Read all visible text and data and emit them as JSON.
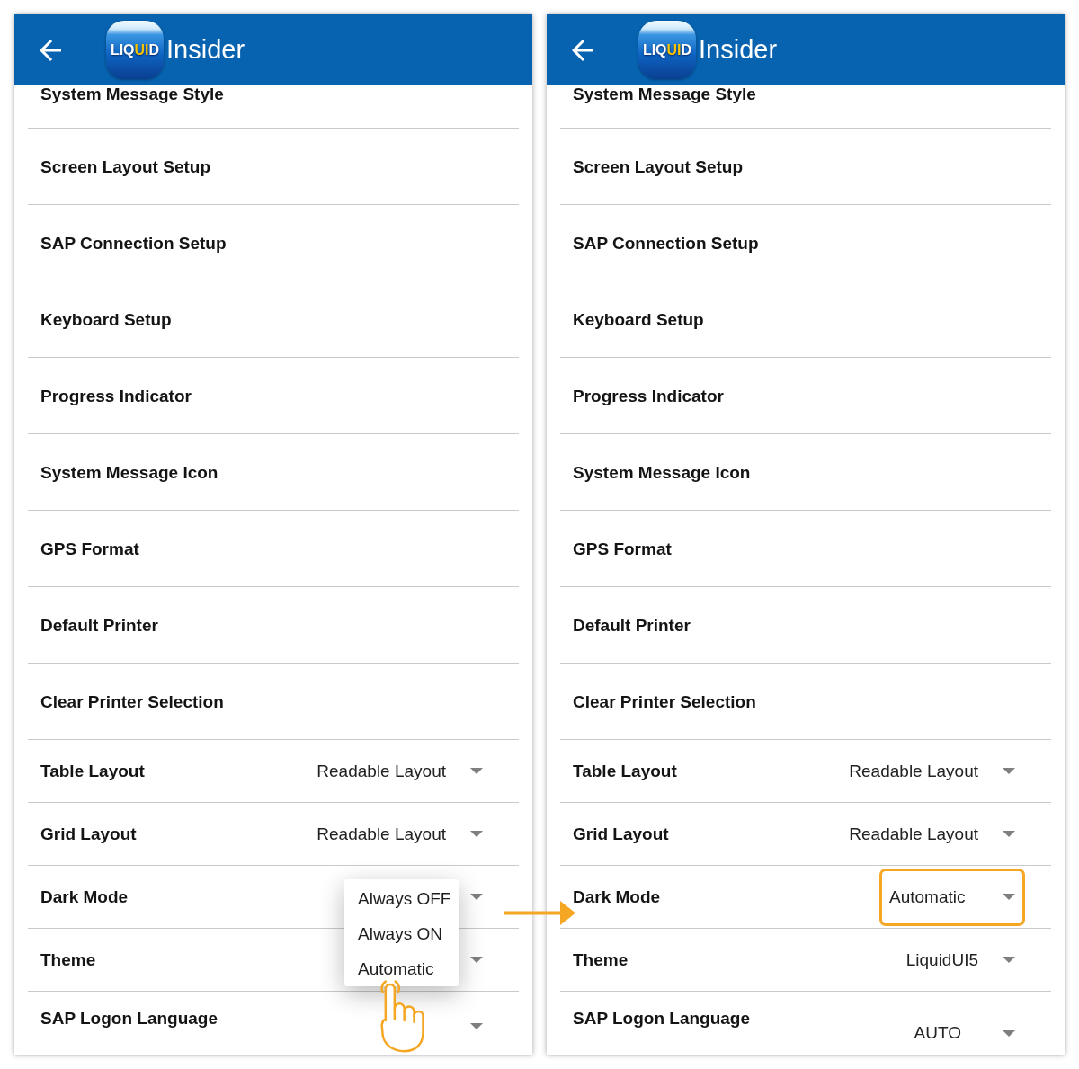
{
  "panels": [
    {
      "header": {
        "logo": [
          {
            "text": "LIQ",
            "color": "#ffffff"
          },
          {
            "text": "UI",
            "color": "#f7c400"
          },
          {
            "text": "D",
            "color": "#ffffff"
          }
        ],
        "title": "Insider"
      },
      "rows": [
        {
          "kind": "link",
          "label": "System Message Style"
        },
        {
          "kind": "link",
          "label": "Screen Layout Setup"
        },
        {
          "kind": "link",
          "label": "SAP Connection Setup"
        },
        {
          "kind": "link",
          "label": "Keyboard Setup"
        },
        {
          "kind": "link",
          "label": "Progress Indicator"
        },
        {
          "kind": "link",
          "label": "System Message Icon"
        },
        {
          "kind": "link",
          "label": "GPS Format"
        },
        {
          "kind": "link",
          "label": "Default Printer"
        },
        {
          "kind": "link",
          "label": "Clear Printer Selection"
        },
        {
          "kind": "select",
          "label": "Table Layout",
          "value": "Readable Layout",
          "highlighted": false
        },
        {
          "kind": "select",
          "label": "Grid Layout",
          "value": "Readable Layout",
          "highlighted": false
        },
        {
          "kind": "select",
          "label": "Dark Mode",
          "highlighted": false,
          "menu": [
            {
              "label": "Always OFF",
              "tapped": false
            },
            {
              "label": "Always ON",
              "tapped": false
            },
            {
              "label": "Automatic",
              "tapped": true
            }
          ]
        },
        {
          "kind": "select",
          "label": "Theme",
          "highlighted": false
        },
        {
          "kind": "stacked",
          "label": "SAP Logon Language",
          "highlighted": false
        }
      ]
    },
    {
      "header": {
        "logo": [
          {
            "text": "LIQ",
            "color": "#ffffff"
          },
          {
            "text": "UI",
            "color": "#f7c400"
          },
          {
            "text": "D",
            "color": "#ffffff"
          }
        ],
        "title": "Insider"
      },
      "rows": [
        {
          "kind": "link",
          "label": "System Message Style"
        },
        {
          "kind": "link",
          "label": "Screen Layout Setup"
        },
        {
          "kind": "link",
          "label": "SAP Connection Setup"
        },
        {
          "kind": "link",
          "label": "Keyboard Setup"
        },
        {
          "kind": "link",
          "label": "Progress Indicator"
        },
        {
          "kind": "link",
          "label": "System Message Icon"
        },
        {
          "kind": "link",
          "label": "GPS Format"
        },
        {
          "kind": "link",
          "label": "Default Printer"
        },
        {
          "kind": "link",
          "label": "Clear Printer Selection"
        },
        {
          "kind": "select",
          "label": "Table Layout",
          "value": "Readable Layout",
          "highlighted": false
        },
        {
          "kind": "select",
          "label": "Grid Layout",
          "value": "Readable Layout",
          "highlighted": false
        },
        {
          "kind": "select",
          "label": "Dark Mode",
          "value": "Automatic",
          "highlighted": true
        },
        {
          "kind": "select",
          "label": "Theme",
          "value": "LiquidUI5",
          "highlighted": false
        },
        {
          "kind": "stacked",
          "label": "SAP Logon Language",
          "value": "AUTO",
          "highlighted": false
        }
      ]
    }
  ]
}
